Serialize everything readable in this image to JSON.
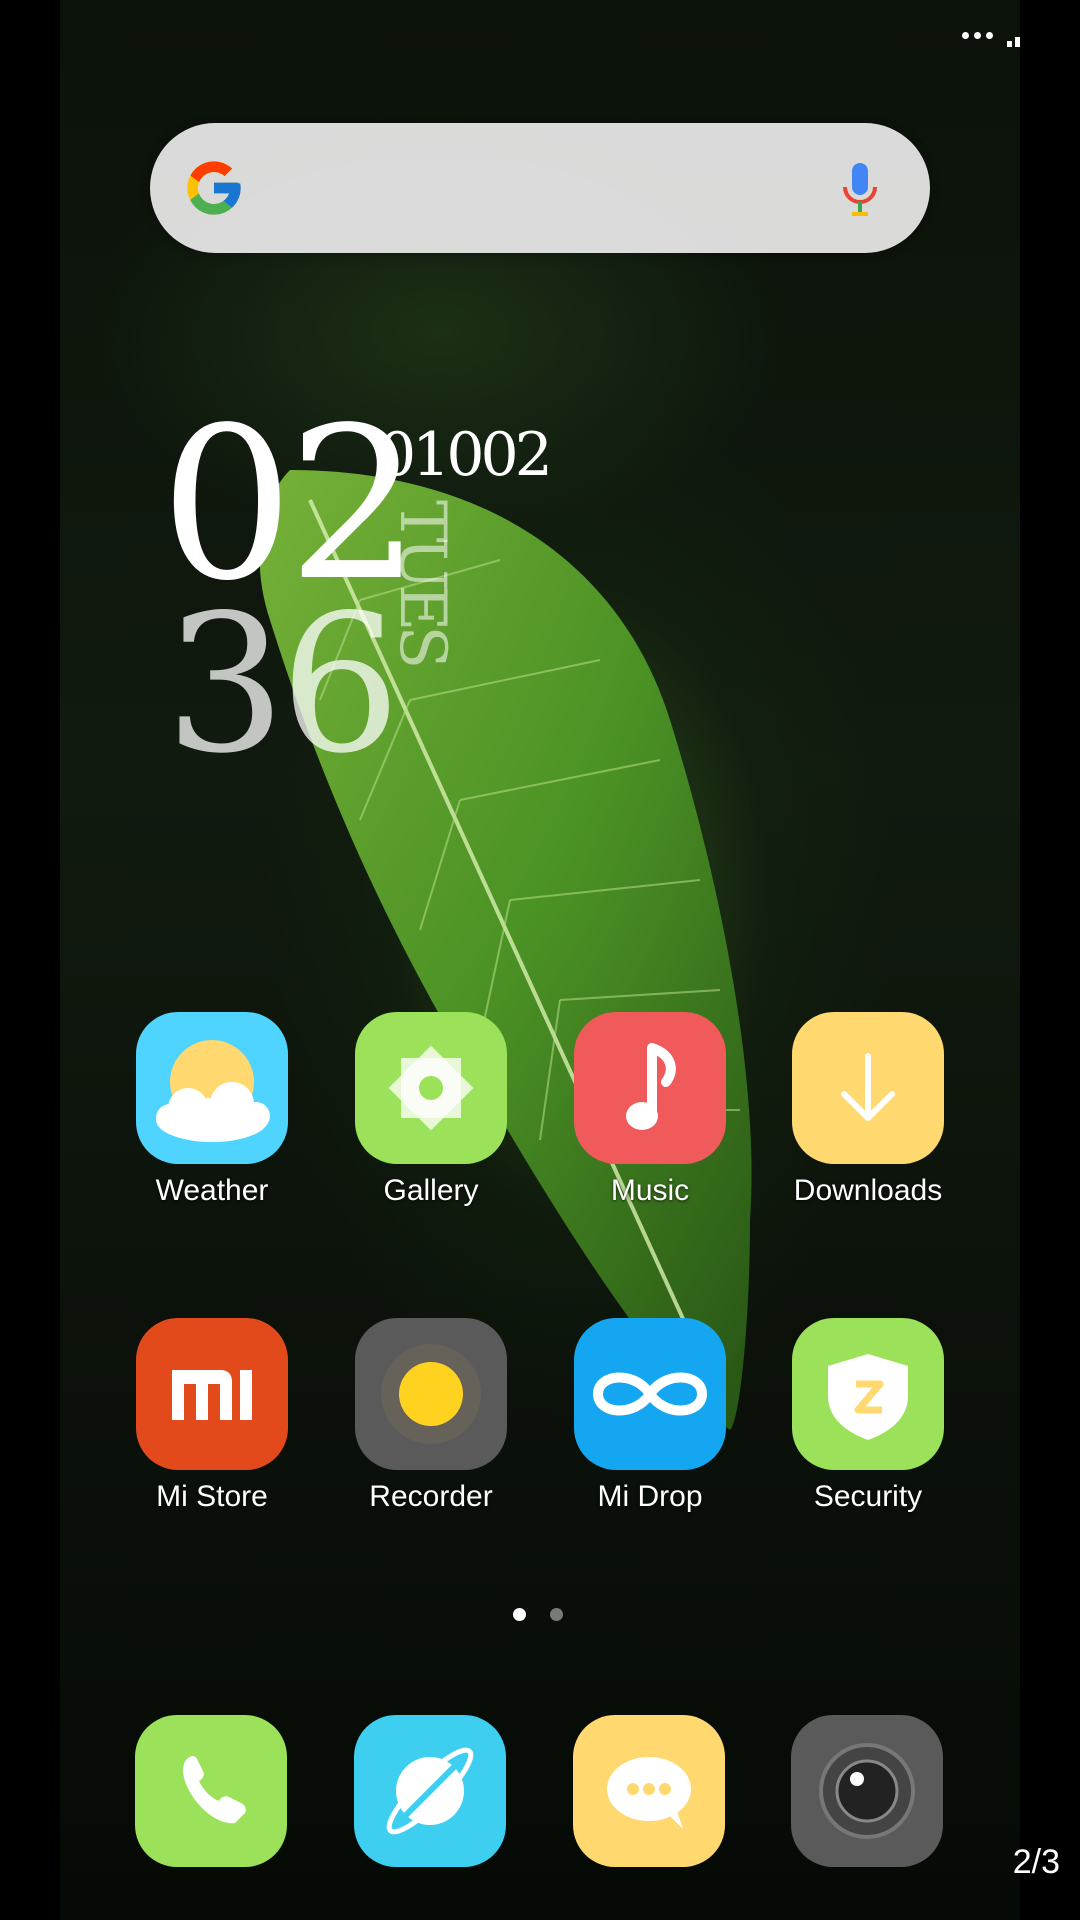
{
  "status_bar": {
    "icons": [
      "more-dots-icon",
      "cell-signal-icon",
      "wifi-icon",
      "battery-icon"
    ]
  },
  "search_bar": {
    "logo": "google-g-icon",
    "mic": "microphone-icon"
  },
  "clock": {
    "hour": "02",
    "minute": "36",
    "date": "01002",
    "day": "TUES"
  },
  "apps": [
    {
      "label": "Weather",
      "icon": "weather-icon",
      "color": "#4fd3ff"
    },
    {
      "label": "Gallery",
      "icon": "gallery-icon",
      "color": "#9be25a"
    },
    {
      "label": "Music",
      "icon": "music-icon",
      "color": "#f15a5a"
    },
    {
      "label": "Downloads",
      "icon": "downloads-icon",
      "color": "#ffd870"
    },
    {
      "label": "Mi Store",
      "icon": "mi-store-icon",
      "color": "#e24a1c"
    },
    {
      "label": "Recorder",
      "icon": "recorder-icon",
      "color": "#5a5a5a"
    },
    {
      "label": "Mi Drop",
      "icon": "mi-drop-icon",
      "color": "#14a6f0"
    },
    {
      "label": "Security",
      "icon": "security-icon",
      "color": "#9be25a"
    }
  ],
  "page_dots": {
    "count": 2,
    "active": 0
  },
  "dock": [
    {
      "icon": "phone-icon",
      "color": "#9be25a"
    },
    {
      "icon": "browser-icon",
      "color": "#3ecff0"
    },
    {
      "icon": "messaging-icon",
      "color": "#ffd870"
    },
    {
      "icon": "camera-icon",
      "color": "#5a5a5a"
    }
  ],
  "overlay": {
    "page_indicator": "2/3"
  }
}
